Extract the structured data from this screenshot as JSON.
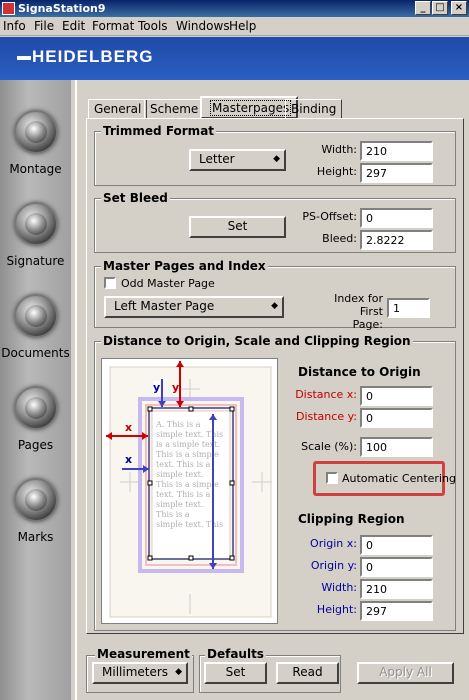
{
  "window": {
    "title": "SignaStation9",
    "min": "_",
    "max": "□",
    "close": "×"
  },
  "menu": [
    "Info",
    "File",
    "Edit",
    "Format",
    "Tools",
    "Windows",
    "Help"
  ],
  "brand": "HEIDELBERG",
  "sidebar": [
    {
      "label": "Montage"
    },
    {
      "label": "Signature"
    },
    {
      "label": "Documents"
    },
    {
      "label": "Pages"
    },
    {
      "label": "Marks"
    }
  ],
  "tabs": [
    {
      "label": "General"
    },
    {
      "label": "Scheme"
    },
    {
      "label": "Masterpages"
    },
    {
      "label": "Binding"
    }
  ],
  "trimmed": {
    "title": "Trimmed Format",
    "format": "Letter",
    "width_label": "Width:",
    "width": "210",
    "height_label": "Height:",
    "height": "297"
  },
  "bleed": {
    "title": "Set Bleed",
    "set": "Set",
    "ps_label": "PS-Offset:",
    "ps": "0",
    "bleed_label": "Bleed:",
    "bleed": "2.8222"
  },
  "master": {
    "title": "Master  Pages and Index",
    "odd": "Odd Master Page",
    "select": "Left Master Page",
    "index_label1": "Index for",
    "index_label2": "First Page:",
    "index": "1"
  },
  "distance": {
    "title": "Distance to Origin, Scale and Clipping Region",
    "sub": "Distance to Origin",
    "dx_label": "Distance x:",
    "dx": "0",
    "dy_label": "Distance y:",
    "dy": "0",
    "scale_label": "Scale (%):",
    "scale": "100",
    "auto": "Automatic Centering"
  },
  "clip": {
    "title": "Clipping Region",
    "ox_label": "Origin x:",
    "ox": "0",
    "oy_label": "Origin y:",
    "oy": "0",
    "w_label": "Width:",
    "w": "210",
    "h_label": "Height:",
    "h": "297"
  },
  "preview": {
    "y": "y",
    "x": "x",
    "text": "A. This is a simple text. This is a simple text. This is a simple text. This is a simple text. This is a simple text. This is a simple text."
  },
  "bottom": {
    "measure_title": "Measurement",
    "measure": "Millimeters",
    "defaults_title": "Defaults",
    "set": "Set",
    "read": "Read",
    "apply": "Apply All"
  }
}
